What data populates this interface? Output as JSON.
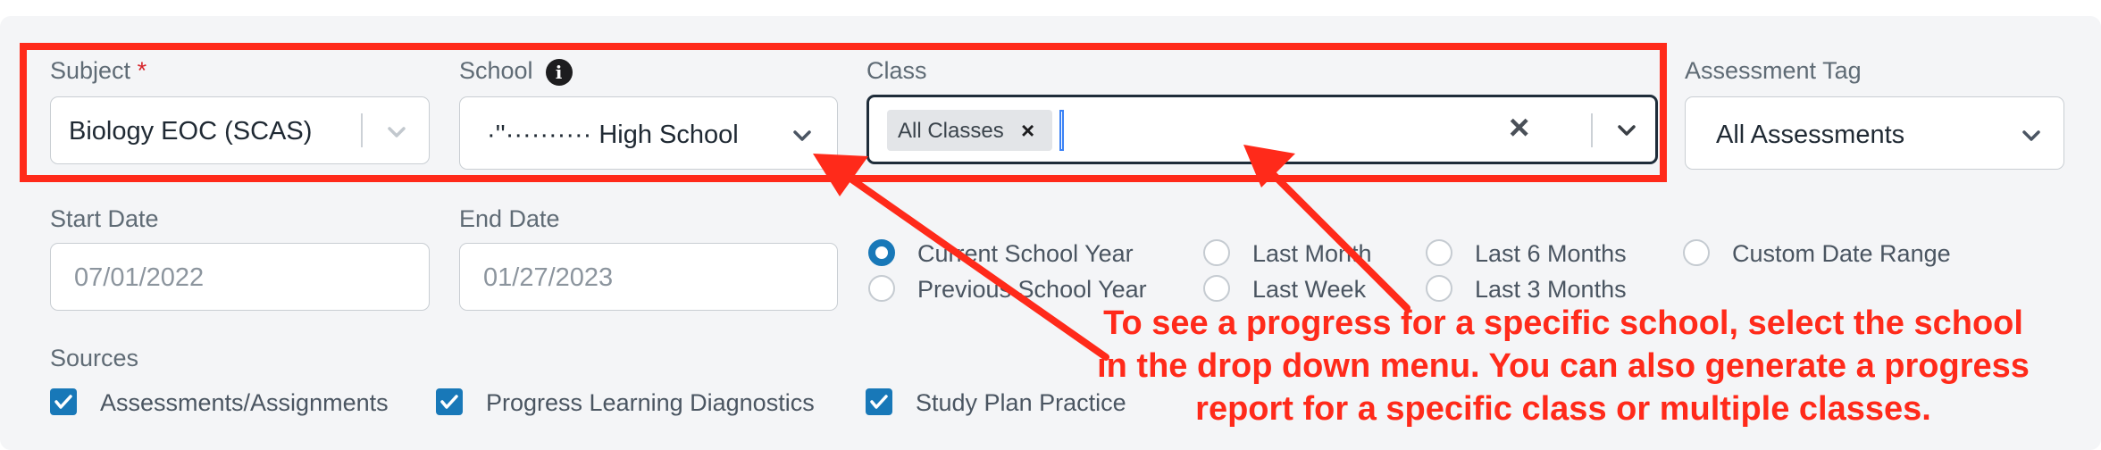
{
  "filters": {
    "subject": {
      "label": "Subject",
      "required_mark": "*",
      "value": "Biology EOC (SCAS)"
    },
    "school": {
      "label": "School",
      "value": "·''·········· High School"
    },
    "class": {
      "label": "Class",
      "tag": "All Classes",
      "tag_remove": "×",
      "clear": "×"
    },
    "assessment_tag": {
      "label": "Assessment Tag",
      "value": "All Assessments"
    },
    "start_date": {
      "label": "Start Date",
      "value": "07/01/2022"
    },
    "end_date": {
      "label": "End Date",
      "value": "01/27/2023"
    }
  },
  "date_ranges": [
    {
      "label": "Current School Year",
      "selected": true
    },
    {
      "label": "Previous School Year",
      "selected": false
    },
    {
      "label": "Last Month",
      "selected": false
    },
    {
      "label": "Last Week",
      "selected": false
    },
    {
      "label": "Last 6 Months",
      "selected": false
    },
    {
      "label": "Last 3 Months",
      "selected": false
    },
    {
      "label": "Custom Date Range",
      "selected": false
    }
  ],
  "sources": {
    "label": "Sources",
    "items": [
      {
        "label": "Assessments/Assignments",
        "checked": true
      },
      {
        "label": "Progress Learning Diagnostics",
        "checked": true
      },
      {
        "label": "Study Plan Practice",
        "checked": true
      }
    ]
  },
  "annotation": {
    "lines": [
      "To see a progress for a specific school, select the school",
      "in the drop down menu.  You can also generate a progress",
      "report for a specific class or multiple classes."
    ],
    "color": "#ff2a1a"
  },
  "colors": {
    "accent": "#1878b8",
    "panel": "#f4f5f7",
    "required": "#d6252b"
  }
}
